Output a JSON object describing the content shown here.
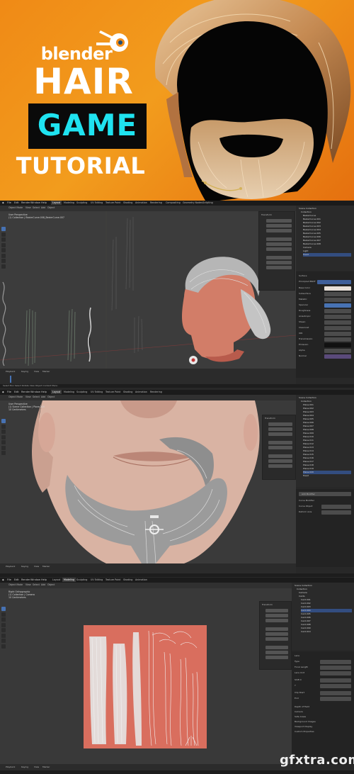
{
  "banner": {
    "logo_word": "blender",
    "title_line1": "HAIR",
    "title_line2": "GAME",
    "title_line3": "TUTORIAL",
    "colors": {
      "bg": "#f28c18",
      "game_text": "#1fe3f0",
      "game_box": "#0a0a0a"
    }
  },
  "menu_items": [
    "File",
    "Edit",
    "Render",
    "Window",
    "Help"
  ],
  "workspaces": [
    "Layout",
    "Modeling",
    "Sculpting",
    "UV Editing",
    "Texture Paint",
    "Shading",
    "Animation",
    "Rendering",
    "Compositing",
    "Geometry Nodes",
    "Scripting"
  ],
  "panel1": {
    "active_workspace": "Layout",
    "header_items": [
      "Object Mode",
      "View",
      "Select",
      "Add",
      "Object"
    ],
    "viewport_info": "User Perspective\n(1) Collection | BezierCurve.008_BezierCurve.007",
    "npanel_title": "Transform",
    "outliner_rows": [
      "Scene Collection",
      "Collection",
      "BezierCurve",
      "BezierCurve.001",
      "BezierCurve.002",
      "BezierCurve.003",
      "BezierCurve.004",
      "BezierCurve.005",
      "BezierCurve.006",
      "BezierCurve.007",
      "BezierCurve.008",
      "Camera",
      "Light",
      "Head"
    ],
    "props_rows": [
      "Surface",
      "Principled BSDF",
      "Base Color",
      "Subsurface",
      "Metallic",
      "Specular",
      "Roughness",
      "Anisotropic",
      "Sheen",
      "Clearcoat",
      "IOR",
      "Transmission",
      "Emission",
      "Alpha",
      "Normal"
    ],
    "timeline_items": [
      "Playback",
      "Keying",
      "View",
      "Marker"
    ],
    "status_text": "Select   Box Select   Rotate View   Object Context Menu"
  },
  "panel2": {
    "active_workspace": "Layout",
    "header_items": [
      "Object Mode",
      "View",
      "Select",
      "Add",
      "Object"
    ],
    "viewport_info": "User Perspective\n(1) Scene Collection | Plane.020\n10 Centimeters",
    "npanel_title": "Transform",
    "outliner_rows": [
      "Scene Collection",
      "Collection",
      "Plane.001",
      "Plane.002",
      "Plane.003",
      "Plane.004",
      "Plane.005",
      "Plane.006",
      "Plane.007",
      "Plane.008",
      "Plane.009",
      "Plane.010",
      "Plane.011",
      "Plane.012",
      "Plane.013",
      "Plane.014",
      "Plane.015",
      "Plane.016",
      "Plane.017",
      "Plane.018",
      "Plane.019",
      "Plane.020",
      "Head"
    ],
    "props_rows": [
      "Add Modifier",
      "Curve Modifier",
      "Curve Object",
      "Deform Axis"
    ],
    "timeline_items": [
      "Playback",
      "Keying",
      "View",
      "Marker"
    ]
  },
  "panel3": {
    "active_workspace": "Modeling",
    "header_items": [
      "Object Mode",
      "View",
      "Select",
      "Add",
      "Object"
    ],
    "viewport_info": "Right Orthographic\n(1) Collection | Camera\n10 Centimeters",
    "npanel_title": "Transform",
    "outliner_rows": [
      "Scene Collection",
      "Collection",
      "Camera",
      "Cards",
      "Card.001",
      "Card.002",
      "Card.003",
      "Card.004",
      "Card.005",
      "Card.006",
      "Card.007",
      "Card.008",
      "Card.009",
      "Card.010"
    ],
    "props_rows": [
      "Lens",
      "Type",
      "Focal Length",
      "Lens Unit",
      "Shift X",
      "Y",
      "Clip Start",
      "End",
      "Depth of Field",
      "Camera",
      "Safe Areas",
      "Background Images",
      "Viewport Display",
      "Custom Properties"
    ],
    "timeline_items": [
      "Playback",
      "Keying",
      "View",
      "Marker"
    ]
  },
  "watermark": "gfxtra.com"
}
